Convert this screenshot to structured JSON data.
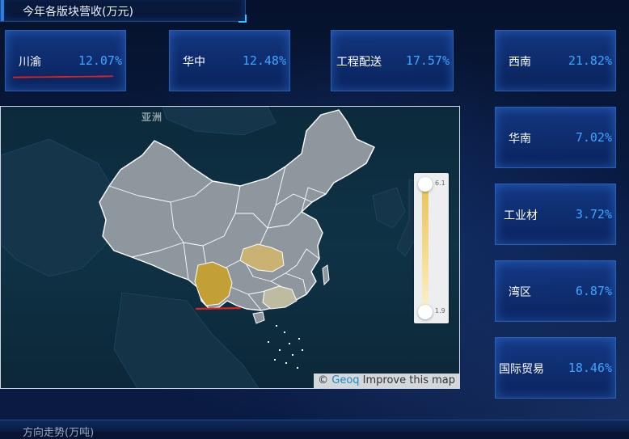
{
  "header": {
    "title": "今年各版块营收(万元)"
  },
  "cards": [
    {
      "name": "川渝",
      "value": "12.07%"
    },
    {
      "name": "华中",
      "value": "12.48%"
    },
    {
      "name": "工程配送",
      "value": "17.57%"
    },
    {
      "name": "西南",
      "value": "21.82%"
    },
    {
      "name": "华南",
      "value": "7.02%"
    },
    {
      "name": "工业材",
      "value": "3.72%"
    },
    {
      "name": "湾区",
      "value": "6.87%"
    },
    {
      "name": "国际贸易",
      "value": "18.46%"
    }
  ],
  "map": {
    "continent_label": "亚洲",
    "visual_map": {
      "max_label": "6.1",
      "min_label": "1.9"
    },
    "attribution": {
      "symbol": "©",
      "brand": "Geoq",
      "link": "Improve this map"
    },
    "colors": {
      "region_default": "#8e979e",
      "region_high": "#c2a035",
      "region_mid": "#c9b272",
      "region_low": "#bdbba0",
      "border": "#ffffff"
    }
  },
  "footer": {
    "title": "方向走势(万吨)"
  },
  "colors": {
    "accent_blue": "#3ea6ff",
    "annotation_red": "#e0231c",
    "card_border": "#2b5fb0"
  }
}
